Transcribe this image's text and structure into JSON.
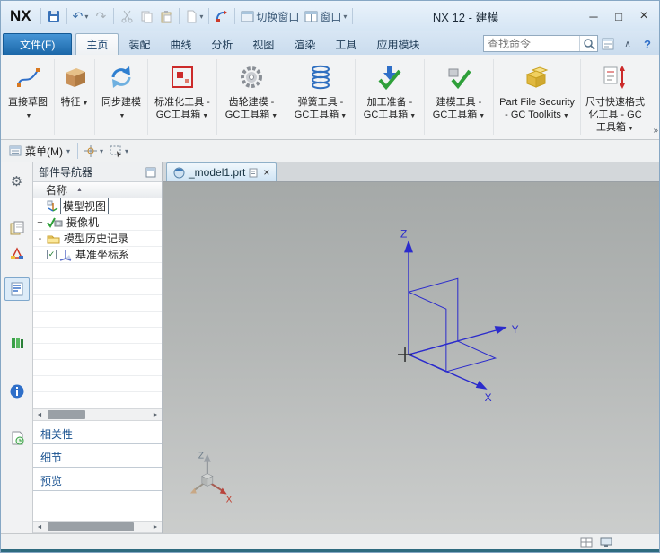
{
  "icons": {
    "dropdown": "▼",
    "dropdown_small": "▾",
    "gear": "⚙",
    "undo": "↶",
    "redo": "↷",
    "minimize": "─",
    "maximize": "□",
    "close": "×",
    "sort_asc": "▲",
    "chevron_up": "∧",
    "help": "?",
    "overflow": "»",
    "scroll_left": "◄",
    "scroll_right": "►",
    "check": "✓",
    "plus": "+",
    "minus": "-"
  },
  "window": {
    "logo": "NX",
    "title": "NX 12 - 建模",
    "toolbar": {
      "switch_window_label": "切换窗口",
      "window_label": "窗口"
    }
  },
  "ribbon": {
    "file_tab": "文件(F)",
    "tabs": [
      {
        "label": "主页"
      },
      {
        "label": "装配"
      },
      {
        "label": "曲线"
      },
      {
        "label": "分析"
      },
      {
        "label": "视图"
      },
      {
        "label": "渲染"
      },
      {
        "label": "工具"
      },
      {
        "label": "应用模块"
      }
    ],
    "search_placeholder": "查找命令",
    "groups": [
      {
        "label": "直接草图"
      },
      {
        "label": "特征"
      },
      {
        "label": "同步建模"
      },
      {
        "label": "标准化工具 - GC工具箱"
      },
      {
        "label": "齿轮建模 - GC工具箱"
      },
      {
        "label": "弹簧工具 - GC工具箱"
      },
      {
        "label": "加工准备 - GC工具箱"
      },
      {
        "label": "建模工具 - GC工具箱"
      },
      {
        "label": "Part File Security - GC Toolkits"
      },
      {
        "label": "尺寸快速格式化工具 - GC工具箱"
      }
    ]
  },
  "menubar": {
    "menu_label": "菜单(M)"
  },
  "part_navigator": {
    "title": "部件导航器",
    "column_header": "名称",
    "tree": [
      {
        "expander": "+",
        "label": "模型视图"
      },
      {
        "expander": "+",
        "label": "摄像机"
      },
      {
        "expander": "-",
        "label": "模型历史记录"
      },
      {
        "label": "基准坐标系",
        "checked": true
      }
    ],
    "sections": [
      {
        "label": "相关性"
      },
      {
        "label": "细节"
      },
      {
        "label": "预览"
      }
    ]
  },
  "graphics": {
    "tab_label": "_model1.prt",
    "csys": {
      "x": "X",
      "y": "Y",
      "z": "Z"
    },
    "triad": {
      "x": "X",
      "z": "Z"
    }
  }
}
